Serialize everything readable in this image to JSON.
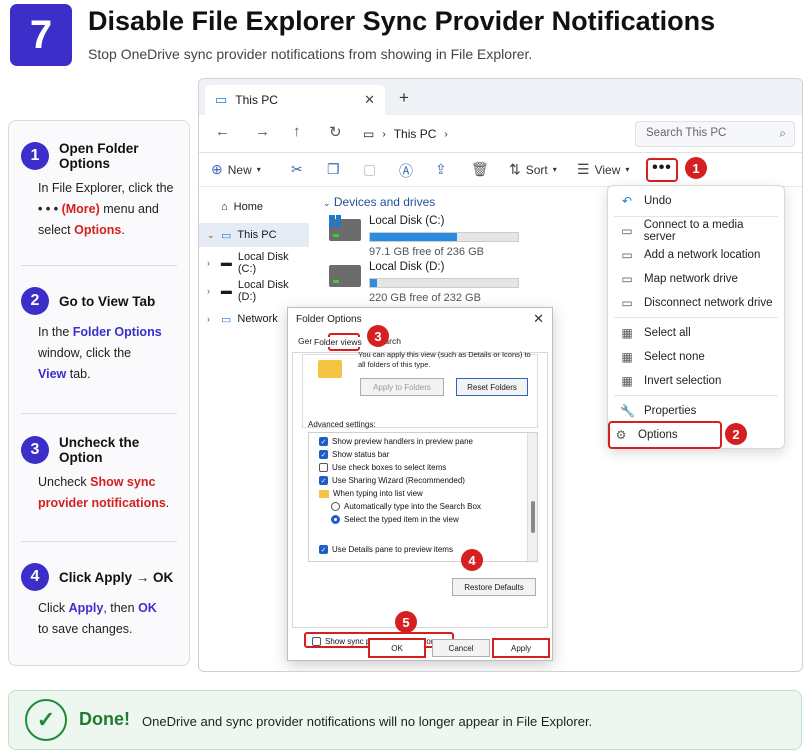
{
  "header": {
    "step_number": "7",
    "title": "Disable File Explorer Sync Provider Notifications",
    "subtitle": "Stop OneDrive sync provider notifications from showing in File Explorer."
  },
  "steps": [
    {
      "num": "1",
      "title": "Open Folder Options",
      "t1": "In File Explorer, click the",
      "t2": "• • •",
      "t3": "(More)",
      "t4": "menu and",
      "t5": "select",
      "t6": "Options",
      "t7": "."
    },
    {
      "num": "2",
      "title": "Go to View Tab",
      "t1": "In the",
      "t2": "Folder Options",
      "t3": "window, click the",
      "t4": "View",
      "t5": "tab."
    },
    {
      "num": "3",
      "title": "Uncheck the Option",
      "t1": "Uncheck",
      "t2": "Show sync",
      "t3": "provider notifications",
      "t4": "."
    },
    {
      "num": "4",
      "title": "Click Apply → OK",
      "t1": "Click",
      "t2": "Apply",
      "t3": ", then",
      "t4": "OK",
      "t5": "to save changes."
    }
  ],
  "explorer": {
    "tab_title": "This PC",
    "tab_close": "✕",
    "new_tab": "+",
    "address": "This PC",
    "search_placeholder": "Search This PC",
    "commands": {
      "new": "New",
      "sort": "Sort",
      "view": "View",
      "more": "•••"
    },
    "nav": [
      "Home",
      "This PC",
      "Local Disk (C:)",
      "Local Disk (D:)",
      "Network"
    ],
    "drives_header": "Devices and drives",
    "drives": [
      {
        "name": "Local Disk (C:)",
        "free": "97.1 GB free of 236 GB",
        "used_fraction": 0.59
      },
      {
        "name": "Local Disk (D:)",
        "free": "220 GB free of 232 GB",
        "used_fraction": 0.05
      }
    ]
  },
  "menu": {
    "items": [
      "Undo",
      "Connect to a media server",
      "Add a network location",
      "Map network drive",
      "Disconnect network drive",
      "Select all",
      "Select none",
      "Invert selection",
      "Properties",
      "Options"
    ]
  },
  "dialog": {
    "title": "Folder Options",
    "close": "✕",
    "tabs": [
      "General",
      "View",
      "Search"
    ],
    "folder_views_label": "Folder views",
    "folder_views_text": "You can apply this view (such as Details or Icons) to all folders of this type.",
    "apply_to_folders": "Apply to Folders",
    "reset_folders": "Reset Folders",
    "advanced_label": "Advanced settings:",
    "advanced_items": [
      {
        "label": "Show preview handlers in preview pane",
        "type": "check",
        "on": true
      },
      {
        "label": "Show status bar",
        "type": "check",
        "on": true
      },
      {
        "label": "Use check boxes to select items",
        "type": "check",
        "on": false
      },
      {
        "label": "Use Sharing Wizard (Recommended)",
        "type": "check",
        "on": true
      },
      {
        "label": "When typing into list view",
        "type": "folder",
        "on": false
      },
      {
        "label": "Automatically type into the Search Box",
        "type": "radio",
        "on": false
      },
      {
        "label": "Select the typed item in the view",
        "type": "radio",
        "on": true
      },
      {
        "label": "Show sync provider notifications",
        "type": "check",
        "on": false
      },
      {
        "label": "Use Details pane to preview items",
        "type": "check",
        "on": true
      }
    ],
    "restore_defaults": "Restore Defaults",
    "ok": "OK",
    "cancel": "Cancel",
    "apply": "Apply"
  },
  "markers": [
    "1",
    "2",
    "3",
    "4",
    "5"
  ],
  "done": {
    "title": "Done!",
    "text": "OneDrive and sync provider notifications will no longer appear in File Explorer."
  },
  "colors": {
    "accent": "#3c2fc9",
    "highlight": "#d42020",
    "success": "#1f8a3a"
  }
}
